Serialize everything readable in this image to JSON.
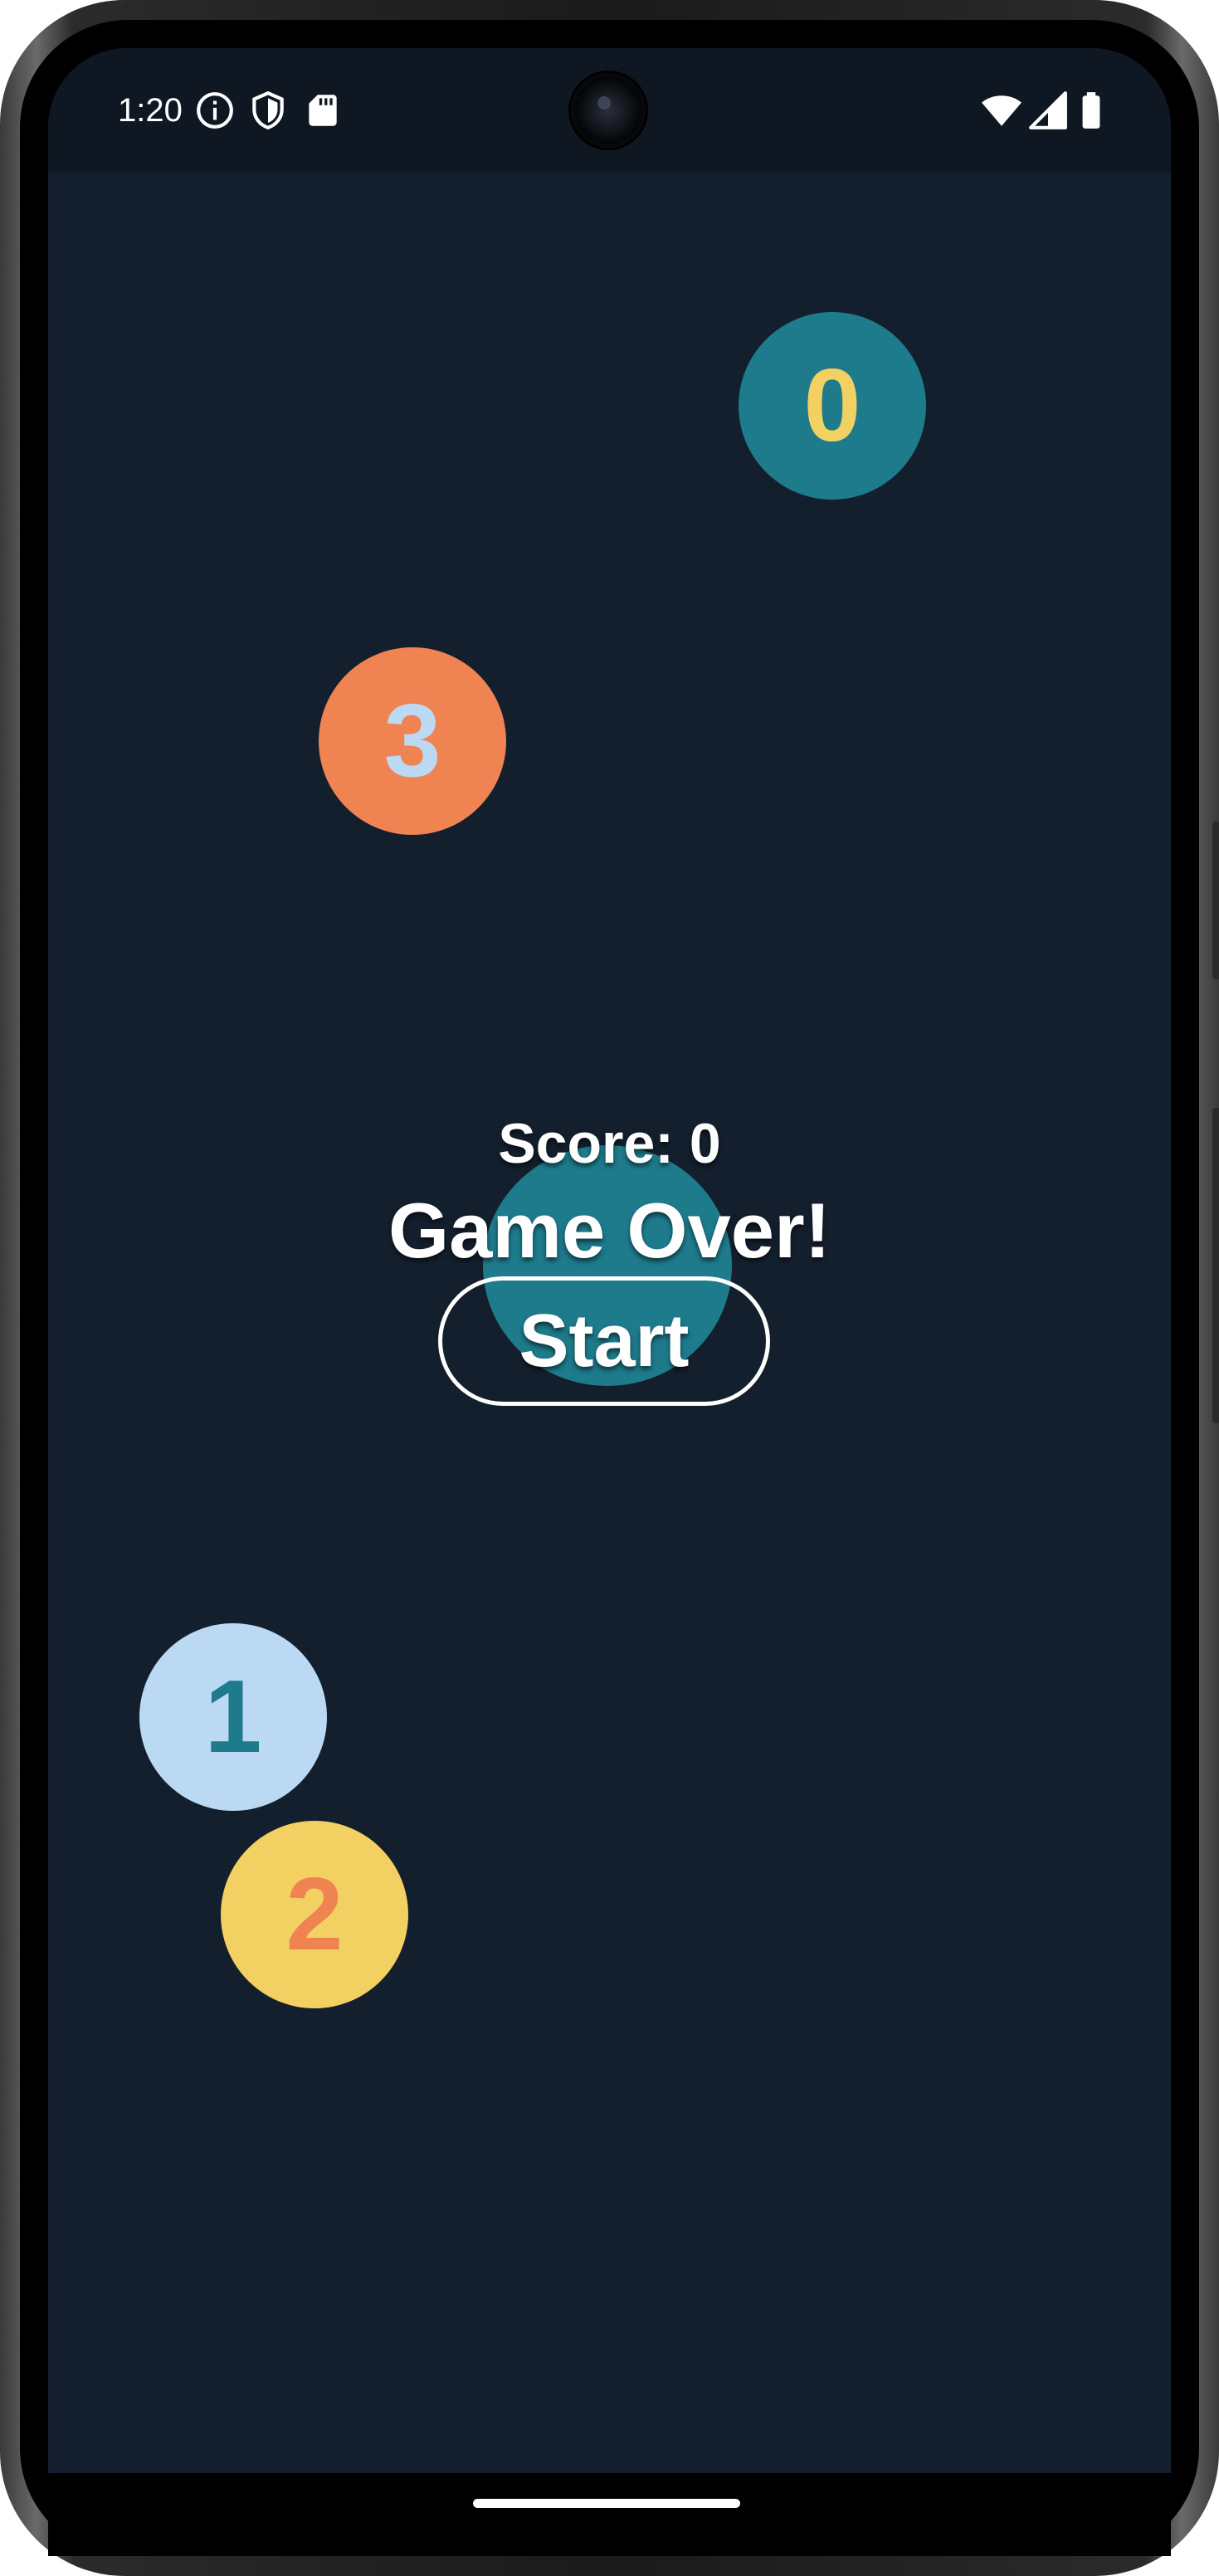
{
  "status_bar": {
    "time": "1:20",
    "left_icons": [
      "info-icon",
      "shield-icon",
      "sd-card-icon"
    ],
    "right_icons": [
      "wifi-icon",
      "signal-icon",
      "battery-icon"
    ]
  },
  "game": {
    "balls": [
      {
        "label": "0",
        "fill": "#1e7b8c",
        "text_color": "#f2d061"
      },
      {
        "label": "3",
        "fill": "#ef8352",
        "text_color": "#bcd9f4"
      },
      {
        "label": "1",
        "fill": "#bcd9f4",
        "text_color": "#1e7b8c"
      },
      {
        "label": "2",
        "fill": "#f2d061",
        "text_color": "#ef8352"
      }
    ],
    "center_ball_fill": "#1e7b8c",
    "score_text": "Score: 0",
    "status_text": "Game Over!",
    "start_label": "Start"
  },
  "colors": {
    "background": "#141f2e",
    "status_bar": "#0f1722"
  }
}
